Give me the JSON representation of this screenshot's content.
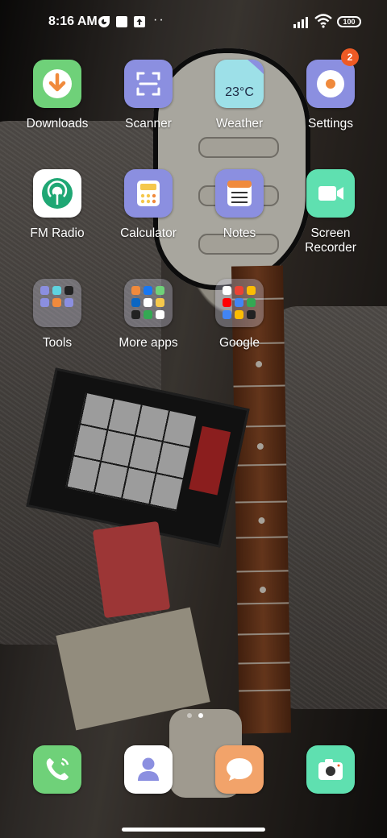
{
  "status_bar": {
    "time": "8:16 AM",
    "battery": "100",
    "notification_icons": [
      "assistant-icon",
      "square-notification-icon",
      "upload-icon"
    ],
    "more": "··"
  },
  "apps": {
    "downloads": {
      "label": "Downloads",
      "color": "#6fd179"
    },
    "scanner": {
      "label": "Scanner",
      "color": "#8b8fe0"
    },
    "weather": {
      "label": "Weather",
      "temp": "23°C",
      "color": "#9de0e8"
    },
    "settings": {
      "label": "Settings",
      "badge": "2",
      "color": "#8b8fe0"
    },
    "fm_radio": {
      "label": "FM Radio",
      "color": "#ffffff"
    },
    "calculator": {
      "label": "Calculator",
      "color": "#8b8fe0"
    },
    "notes": {
      "label": "Notes",
      "color": "#8b8fe0"
    },
    "screen_recorder": {
      "label": "Screen\nRecorder",
      "color": "#5fe0b0"
    },
    "tools": {
      "label": "Tools"
    },
    "more_apps": {
      "label": "More apps"
    },
    "google": {
      "label": "Google"
    }
  },
  "dock": [
    {
      "name": "phone",
      "color": "#6fd179"
    },
    {
      "name": "contacts",
      "color": "#ffffff"
    },
    {
      "name": "messages",
      "color": "#f2a36a"
    },
    {
      "name": "camera",
      "color": "#5fe0b0"
    }
  ],
  "pager": {
    "pages": 2,
    "current": 2
  }
}
